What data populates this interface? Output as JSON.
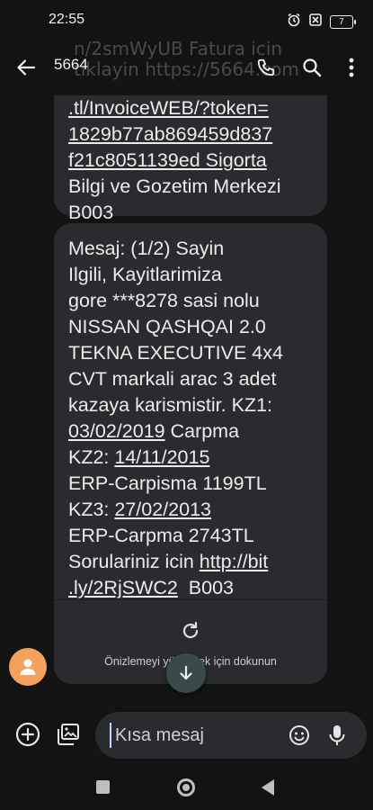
{
  "status_bar": {
    "time": "22:55",
    "battery_level": "7",
    "icons": [
      "alarm-icon",
      "no-sim-icon",
      "battery-icon"
    ]
  },
  "app_bar": {
    "contact": "5664",
    "ghost_line_1": "n/2smWyUB Fatura icin",
    "ghost_line_2": "tiklayin https://5664.com",
    "icons": [
      "back-arrow-icon",
      "phone-icon",
      "search-icon",
      "more-vert-icon"
    ]
  },
  "messages": {
    "bubble_1": {
      "lines": [
        ".tl/InvoiceWEB/?token=",
        "1829b77ab869459d837",
        "f21c8051139ed Sigorta",
        "Bilgi ve Gozetim Merkezi",
        "B003"
      ]
    },
    "bubble_2": {
      "line_1": "Mesaj: (1/2) Sayin",
      "line_2": "Ilgili, Kayitlarimiza",
      "line_3": "gore ***8278 sasi nolu",
      "line_4": "NISSAN QASHQAI 2.0",
      "line_5": "TEKNA EXECUTIVE 4x4",
      "line_6": "CVT markali arac 3 adet",
      "line_7": "kazaya karismistir. KZ1:",
      "kz1_date": "03/02/2019",
      "kz1_type": " Carpma",
      "kz2_label": "KZ2: ",
      "kz2_date": "14/11/2015",
      "line_10": "ERP-Carpisma 1199TL",
      "kz3_label": "KZ3: ",
      "kz3_date": "27/02/2013",
      "line_12": "ERP-Carpma 2743TL",
      "line_13_text": "Sorulariniz icin ",
      "link_part_1": "http://bit",
      "link_part_2": ".ly/2RjSWC2",
      "line_14_suffix": "  B003"
    },
    "preview_label": "Önizlemeyi yüklemek için dokunun"
  },
  "composer": {
    "placeholder": "Kısa mesaj",
    "value": ""
  },
  "colors": {
    "background": "#131313",
    "bubble": "#2a2b2e",
    "avatar": "#f3a25e",
    "fab": "#3a4a4a"
  }
}
